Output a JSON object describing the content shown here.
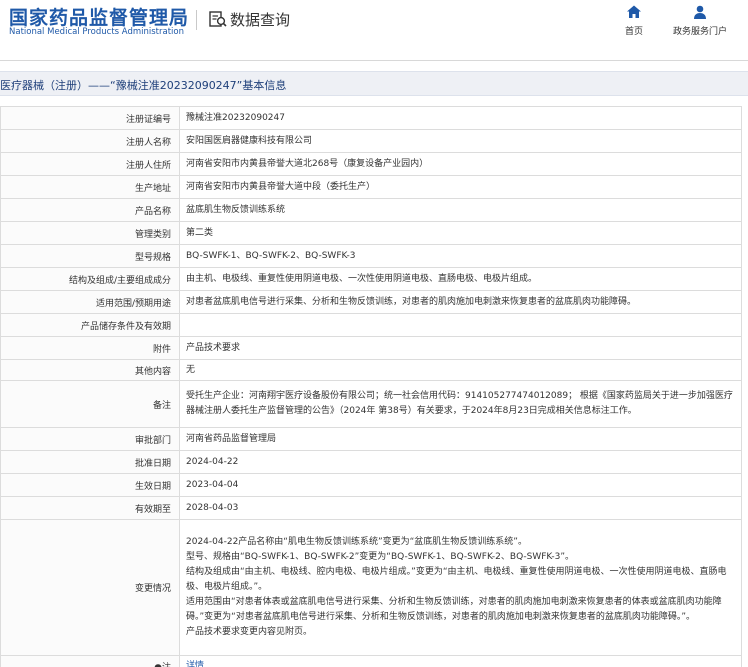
{
  "header": {
    "logo_cn": "国家药品监督管理局",
    "logo_en": "National Medical Products Administration",
    "section_title": "数据查询",
    "nav": [
      {
        "label": "首页",
        "icon": "home-icon"
      },
      {
        "label": "政务服务门户",
        "icon": "user-icon"
      }
    ]
  },
  "title_bar": "医疗器械（注册）——“豫械注准20232090247”基本信息",
  "colors": {
    "brand": "#1f59a8",
    "title_bg": "#eef0f5",
    "border": "#dcdcdc"
  },
  "rows": [
    {
      "label": "注册证编号",
      "value": "豫械注准20232090247"
    },
    {
      "label": "注册人名称",
      "value": "安阳国医肩器健康科技有限公司"
    },
    {
      "label": "注册人住所",
      "value": "河南省安阳市内黄县帝誉大道北268号（康复设备产业园内）"
    },
    {
      "label": "生产地址",
      "value": "河南省安阳市内黄县帝誉大道中段（委托生产）"
    },
    {
      "label": "产品名称",
      "value": "盆底肌生物反馈训练系统"
    },
    {
      "label": "管理类别",
      "value": "第二类"
    },
    {
      "label": "型号规格",
      "value": "BQ-SWFK-1、BQ-SWFK-2、BQ-SWFK-3"
    },
    {
      "label": "结构及组成/主要组成成分",
      "value": "由主机、电极线、重复性使用阴道电极、一次性使用阴道电极、直肠电极、电极片组成。"
    },
    {
      "label": "适用范围/预期用途",
      "value": "对患者盆底肌电信号进行采集、分析和生物反馈训练，对患者的肌肉施加电刺激来恢复患者的盆底肌肉功能障碍。"
    },
    {
      "label": "产品储存条件及有效期",
      "value": ""
    },
    {
      "label": "附件",
      "value": "产品技术要求"
    },
    {
      "label": "其他内容",
      "value": "无"
    },
    {
      "label": "备注",
      "value": "受托生产企业：河南翔宇医疗设备股份有限公司；统一社会信用代码：914105277474012089； 根据《国家药监局关于进一步加强医疗器械注册人委托生产监督管理的公告》（2024年 第38号）有关要求，于2024年8月23日完成相关信息标注工作。"
    },
    {
      "label": "审批部门",
      "value": "河南省药品监督管理局"
    },
    {
      "label": "批准日期",
      "value": "2024-04-22"
    },
    {
      "label": "生效日期",
      "value": "2023-04-04"
    },
    {
      "label": "有效期至",
      "value": "2028-04-03"
    }
  ],
  "change_row": {
    "label": "变更情况",
    "lines": [
      "2024-04-22产品名称由“肌电生物反馈训练系统”变更为“盆底肌生物反馈训练系统”。",
      "型号、规格由“BQ-SWFK-1、BQ-SWFK-2”变更为“BQ-SWFK-1、BQ-SWFK-2、BQ-SWFK-3”。",
      "结构及组成由“由主机、电极线、腔内电极、电极片组成。”变更为“由主机、电极线、重复性使用阴道电极、一次性使用阴道电极、直肠电极、电极片组成。”。",
      "适用范围由“对患者体表或盆底肌电信号进行采集、分析和生物反馈训练，对患者的肌肉施加电刺激来恢复患者的体表或盆底肌肉功能障碍。”变更为“对患者盆底肌电信号进行采集、分析和生物反馈训练，对患者的肌肉施加电刺激来恢复患者的盆底肌肉功能障碍。”。",
      "产品技术要求变更内容见附页。"
    ]
  },
  "note_row": {
    "label": "●注",
    "link": "详情"
  }
}
